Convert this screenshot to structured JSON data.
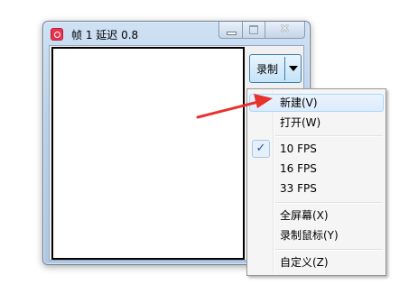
{
  "window": {
    "title": "帧 1 延迟 0.8",
    "close_glyph": "✕"
  },
  "toolbar": {
    "record_label": "录制"
  },
  "menu": {
    "items": [
      {
        "label": "新建(V)",
        "hovered": true
      },
      {
        "label": "打开(W)"
      },
      {
        "label": "10 FPS",
        "checked": true,
        "check_glyph": "✓"
      },
      {
        "label": "16 FPS"
      },
      {
        "label": "33 FPS"
      },
      {
        "label": "全屏幕(X)"
      },
      {
        "label": "录制鼠标(Y)"
      },
      {
        "label": "自定义(Z)"
      }
    ]
  },
  "annotation": {
    "arrow_color": "#e8322d"
  },
  "colors": {
    "hover_border": "#a8d8fb",
    "check_mark": "#1e55a8"
  }
}
